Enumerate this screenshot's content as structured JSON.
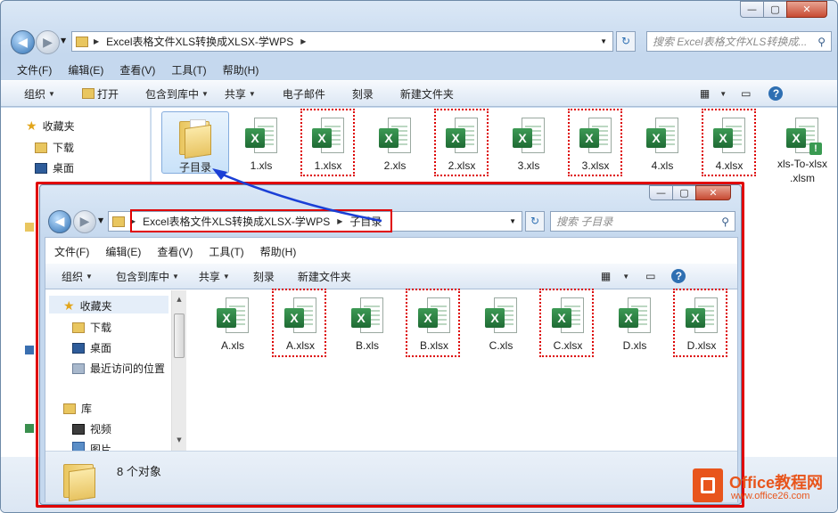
{
  "outer_window": {
    "address_parts": [
      "Excel表格文件XLS转换成XLSX-学WPS"
    ],
    "search_placeholder": "搜索 Excel表格文件XLS转换成...",
    "menu": [
      "文件(F)",
      "编辑(E)",
      "查看(V)",
      "工具(T)",
      "帮助(H)"
    ],
    "commands": {
      "organize": "组织",
      "open": "打开",
      "include": "包含到库中",
      "share": "共享",
      "email": "电子邮件",
      "burn": "刻录",
      "new_folder": "新建文件夹"
    },
    "nav": {
      "favorites": "收藏夹",
      "downloads": "下载",
      "desktop": "桌面"
    },
    "files": [
      "子目录",
      "1.xls",
      "1.xlsx",
      "2.xls",
      "2.xlsx",
      "3.xls",
      "3.xlsx",
      "4.xls",
      "4.xlsx",
      "xls-To-xlsx\n.xlsm"
    ]
  },
  "inner_window": {
    "address_parts": [
      "Excel表格文件XLS转换成XLSX-学WPS",
      "子目录"
    ],
    "search_placeholder": "搜索 子目录",
    "menu": [
      "文件(F)",
      "编辑(E)",
      "查看(V)",
      "工具(T)",
      "帮助(H)"
    ],
    "commands": {
      "organize": "组织",
      "include": "包含到库中",
      "share": "共享",
      "burn": "刻录",
      "new_folder": "新建文件夹"
    },
    "nav": {
      "favorites": "收藏夹",
      "downloads": "下载",
      "desktop": "桌面",
      "recent": "最近访问的位置",
      "library": "库",
      "video": "视频",
      "pictures": "图片"
    },
    "files": [
      "A.xls",
      "A.xlsx",
      "B.xls",
      "B.xlsx",
      "C.xls",
      "C.xlsx",
      "D.xls",
      "D.xlsx"
    ],
    "status": "8 个对象"
  },
  "watermark": {
    "brand": "Office教程网",
    "url": "www.office26.com"
  },
  "colors": {
    "highlight_red": "#e00000",
    "arrow_blue": "#1a3fd6",
    "excel_green": "#217346"
  }
}
